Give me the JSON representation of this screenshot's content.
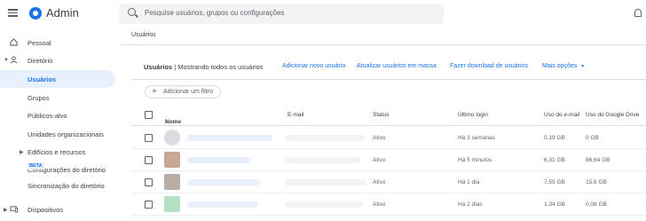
{
  "topbar": {
    "app_title": "Admin",
    "search_placeholder": "Pesquise usuários, grupos ou configurações"
  },
  "sidebar": {
    "items": [
      {
        "label": "Pessoal"
      },
      {
        "label": "Diretório"
      },
      {
        "label": "Usuários"
      },
      {
        "label": "Grupos"
      },
      {
        "label": "Públicos-alvo"
      },
      {
        "label": "Unidades organizacionais"
      },
      {
        "label": "Edifícios e recursos"
      },
      {
        "label": "Configurações do diretório"
      },
      {
        "label": "Sincronização do diretório"
      },
      {
        "label": "Dispositivos"
      }
    ],
    "beta_badge": "BETA"
  },
  "breadcrumb": "Usuários",
  "toolbar": {
    "title_bold": "Usuários",
    "title_rest": " | Mostrando todos os usuários",
    "links": [
      "Adicionar novo usuário",
      "Atualizar usuários em massa",
      "Fazer download de usuários",
      "Mais opções"
    ]
  },
  "filter": {
    "label": "Adicionar um filtro"
  },
  "table": {
    "columns": [
      "Nome",
      "E-mail",
      "Status",
      "Último login",
      "Uso do e-mail",
      "Uso do Google Drive"
    ],
    "rows": [
      {
        "status": "Ativo",
        "last_login": "Há 3 semanas",
        "email_usage": "0,19 GB",
        "drive_usage": "0 GB"
      },
      {
        "status": "Ativo",
        "last_login": "Há 5 minutos",
        "email_usage": "6,31 GB",
        "drive_usage": "86,64 GB"
      },
      {
        "status": "Ativo",
        "last_login": "Há 1 dia",
        "email_usage": "7,55 GB",
        "drive_usage": "15,6 GB"
      },
      {
        "status": "Ativo",
        "last_login": "Há 2 dias",
        "email_usage": "1,34 GB",
        "drive_usage": "0,08 GB"
      }
    ]
  },
  "colors": {
    "accent": "#1a73e8",
    "active_bg": "#e8f0fe"
  }
}
